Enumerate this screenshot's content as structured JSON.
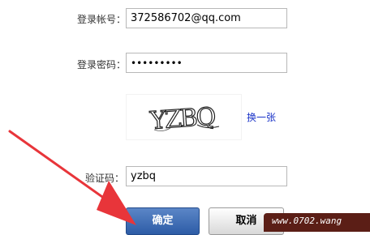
{
  "form": {
    "account_label": "登录帐号：",
    "account_value": "372586702@qq.com",
    "password_label": "登录密码：",
    "password_value": "•••••••••",
    "captcha_label": "验证码：",
    "captcha_value": "yzbq",
    "refresh_label": "换一张"
  },
  "captcha": {
    "image_text": "YZBQ"
  },
  "buttons": {
    "confirm_label": "确定",
    "cancel_label": "取消"
  },
  "watermark": {
    "text": "www.0702.wang"
  },
  "colors": {
    "arrow": "#e8353a",
    "primary_button": "#2d5ca6",
    "link": "#1a33c8"
  },
  "icons": {
    "annotation": "red-arrow-icon"
  }
}
